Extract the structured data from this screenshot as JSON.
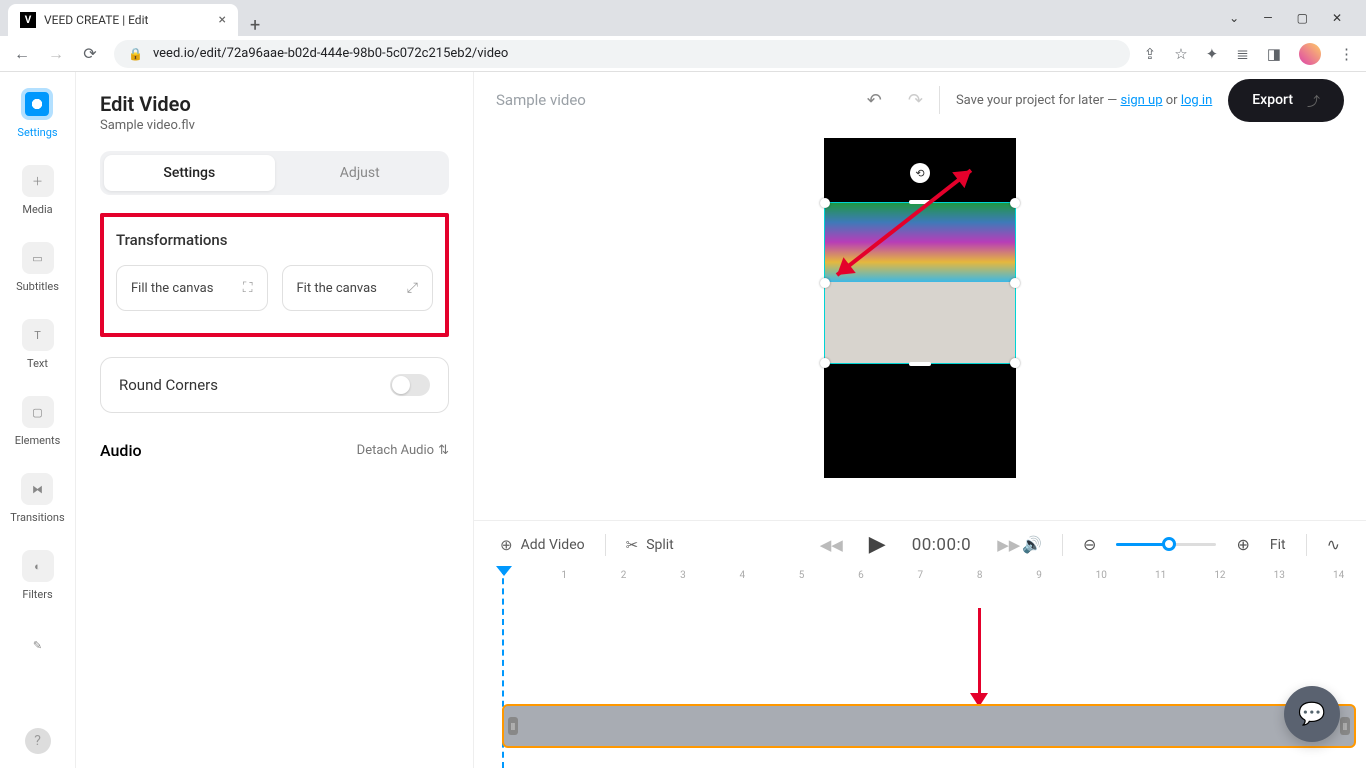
{
  "browser": {
    "tab_title": "VEED CREATE | Edit",
    "tab_favicon": "V",
    "url": "veed.io/edit/72a96aae-b02d-444e-98b0-5c072c215eb2/video"
  },
  "sidebar": {
    "items": [
      {
        "label": "Settings",
        "icon": "settings"
      },
      {
        "label": "Media",
        "icon": "plus"
      },
      {
        "label": "Subtitles",
        "icon": "subtitles"
      },
      {
        "label": "Text",
        "icon": "text"
      },
      {
        "label": "Elements",
        "icon": "elements"
      },
      {
        "label": "Transitions",
        "icon": "transitions"
      },
      {
        "label": "Filters",
        "icon": "filters"
      }
    ]
  },
  "panel": {
    "title": "Edit Video",
    "subtitle": "Sample video.flv",
    "tabs": {
      "settings": "Settings",
      "adjust": "Adjust"
    },
    "transformations": {
      "title": "Transformations",
      "fill": "Fill the canvas",
      "fit": "Fit the canvas"
    },
    "round_corners": "Round Corners",
    "audio": {
      "title": "Audio",
      "detach": "Detach Audio"
    }
  },
  "topbar": {
    "project_name": "Sample video",
    "save_text": "Save your project for later — ",
    "signup": "sign up",
    "or": " or ",
    "login": "log in",
    "export": "Export"
  },
  "timeline": {
    "add_video": "Add Video",
    "split": "Split",
    "time": "00:00:0",
    "fit": "Fit",
    "ticks": [
      "1",
      "2",
      "3",
      "4",
      "5",
      "6",
      "7",
      "8",
      "9",
      "10",
      "11",
      "12",
      "13",
      "14"
    ]
  }
}
